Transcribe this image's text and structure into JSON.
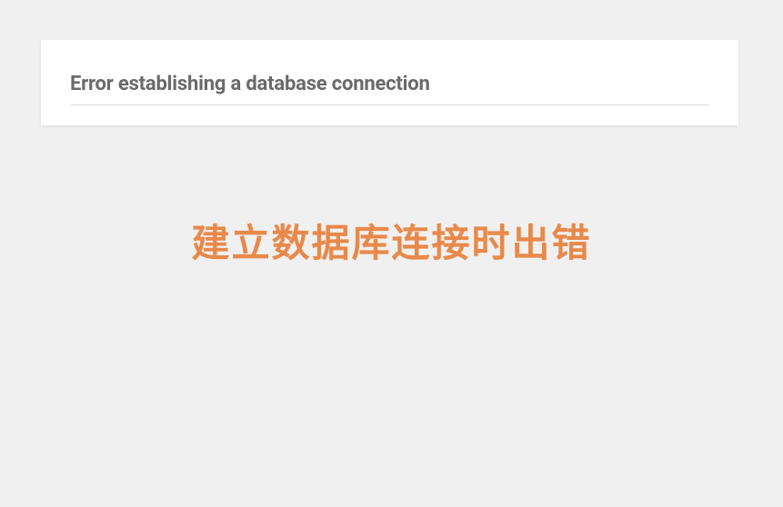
{
  "error": {
    "title_en": "Error establishing a database connection",
    "title_zh": "建立数据库连接时出错"
  }
}
